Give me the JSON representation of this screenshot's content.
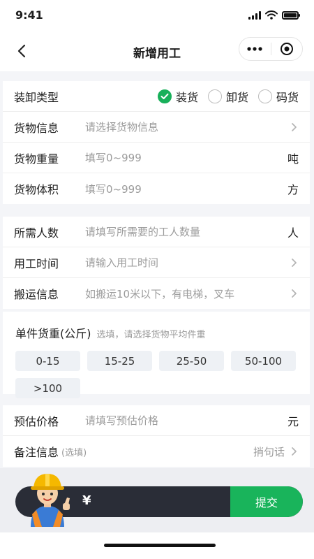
{
  "status": {
    "time": "9:41"
  },
  "nav": {
    "title": "新增用工"
  },
  "type_row": {
    "label": "装卸类型",
    "options": [
      {
        "label": "装货",
        "checked": true
      },
      {
        "label": "卸货",
        "checked": false
      },
      {
        "label": "码货",
        "checked": false
      }
    ]
  },
  "goods_info": {
    "label": "货物信息",
    "placeholder": "请选择货物信息"
  },
  "goods_weight": {
    "label": "货物重量",
    "placeholder": "填写0~999",
    "unit": "吨"
  },
  "goods_volume": {
    "label": "货物体积",
    "placeholder": "填写0~999",
    "unit": "方"
  },
  "workers": {
    "label": "所需人数",
    "placeholder": "请填写所需要的工人数量",
    "unit": "人"
  },
  "work_time": {
    "label": "用工时间",
    "placeholder": "请输入用工时间"
  },
  "transport": {
    "label": "搬运信息",
    "placeholder": "如搬运10米以下，有电梯，叉车"
  },
  "unit_weight": {
    "title": "单件货重(公斤)",
    "hint": "选填，请选择货物平均件重",
    "options": [
      "0-15",
      "15-25",
      "25-50",
      "50-100",
      ">100"
    ]
  },
  "estimate": {
    "label": "预估价格",
    "placeholder": "请填写预估价格",
    "unit": "元"
  },
  "remark": {
    "label": "备注信息",
    "optional": "(选填)",
    "action": "捎句话"
  },
  "bottom": {
    "currency": "¥",
    "submit": "提交"
  },
  "colors": {
    "accent": "#19b45b",
    "bar": "#2a2d37"
  }
}
